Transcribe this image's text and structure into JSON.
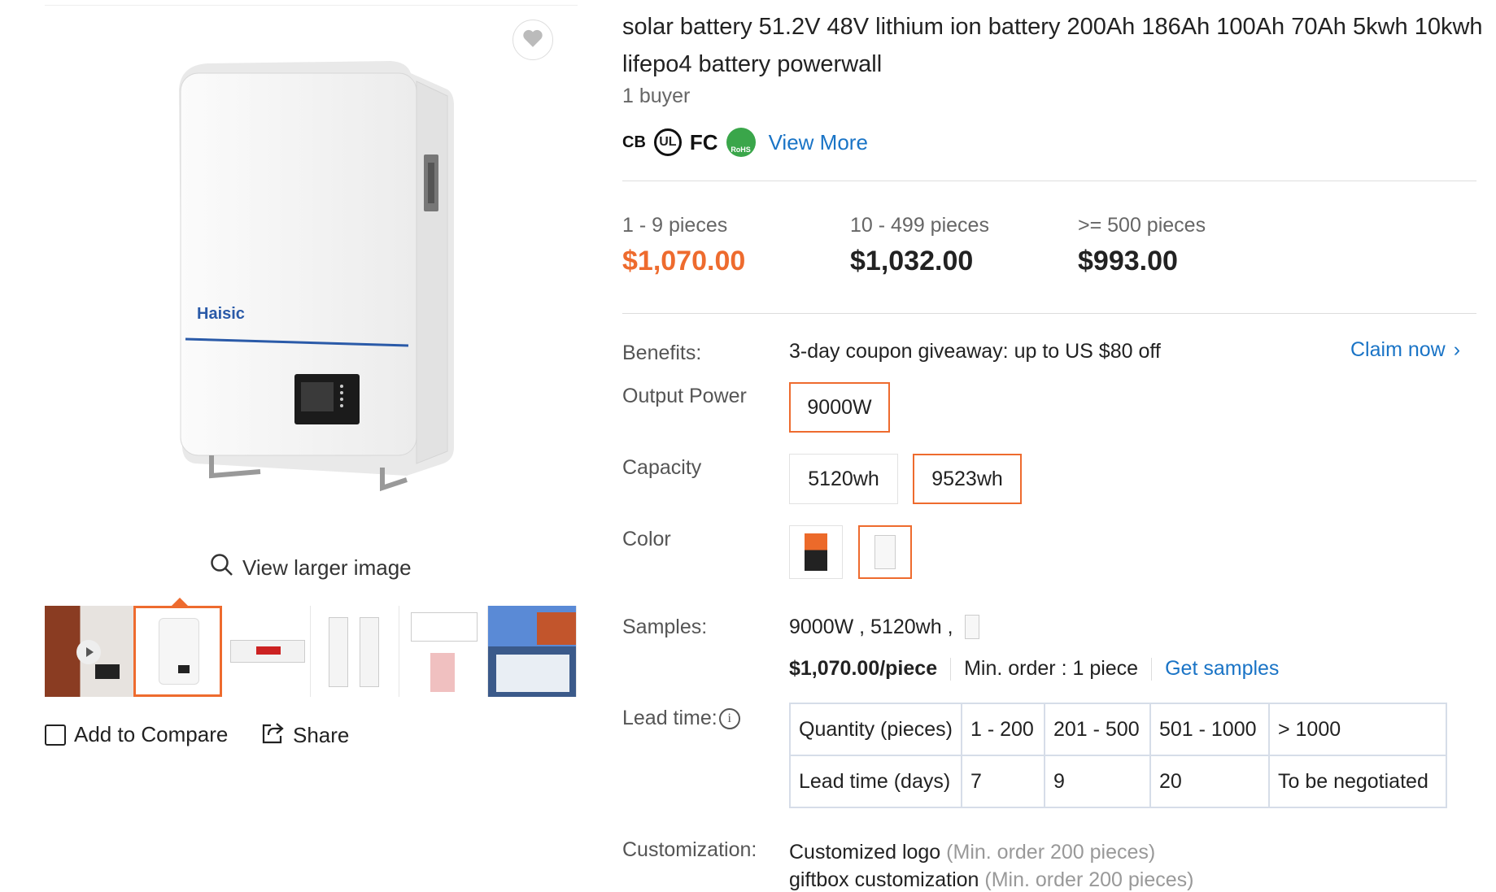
{
  "gallery": {
    "view_larger_label": "View larger image",
    "add_to_compare_label": "Add to Compare",
    "share_label": "Share",
    "product_brand_on_image": "Haisic"
  },
  "product": {
    "title": "solar battery 51.2V 48V lithium ion battery 200Ah 186Ah 100Ah 70Ah 5kwh 10kwh lifepo4 battery powerwall",
    "buyers": "1 buyer",
    "certifications": [
      "CB",
      "UL",
      "FC",
      "RoHS"
    ],
    "view_more_label": "View More"
  },
  "pricing": {
    "tiers": [
      {
        "quantity": "1 - 9 pieces",
        "price": "$1,070.00",
        "highlight": true
      },
      {
        "quantity": "10 - 499 pieces",
        "price": "$1,032.00",
        "highlight": false
      },
      {
        "quantity": ">= 500 pieces",
        "price": "$993.00",
        "highlight": false
      }
    ],
    "highlight_color": "#ee6b2e"
  },
  "benefits": {
    "label": "Benefits:",
    "text": "3-day coupon giveaway: up to US $80 off",
    "claim_label": "Claim now"
  },
  "options": {
    "output_power": {
      "label": "Output Power",
      "values": [
        "9000W"
      ],
      "selected": "9000W"
    },
    "capacity": {
      "label": "Capacity",
      "values": [
        "5120wh",
        "9523wh"
      ],
      "selected": "9523wh"
    },
    "color": {
      "label": "Color",
      "swatches": [
        "orange-black",
        "white"
      ],
      "selected": "white"
    }
  },
  "samples": {
    "label": "Samples:",
    "selection": "9000W , 5120wh ,",
    "price": "$1,070.00/piece",
    "min_order": "Min. order : 1 piece",
    "get_samples_label": "Get samples"
  },
  "lead_time": {
    "label": "Lead time:",
    "headers": [
      "Quantity (pieces)",
      "1 - 200",
      "201 - 500",
      "501 - 1000",
      "> 1000"
    ],
    "row": [
      "Lead time (days)",
      "7",
      "9",
      "20",
      "To be negotiated"
    ]
  },
  "customization": {
    "label": "Customization:",
    "items": [
      {
        "name": "Customized logo",
        "note": "(Min. order 200 pieces)"
      },
      {
        "name": "giftbox customization",
        "note": "(Min. order 200 pieces)"
      }
    ]
  }
}
